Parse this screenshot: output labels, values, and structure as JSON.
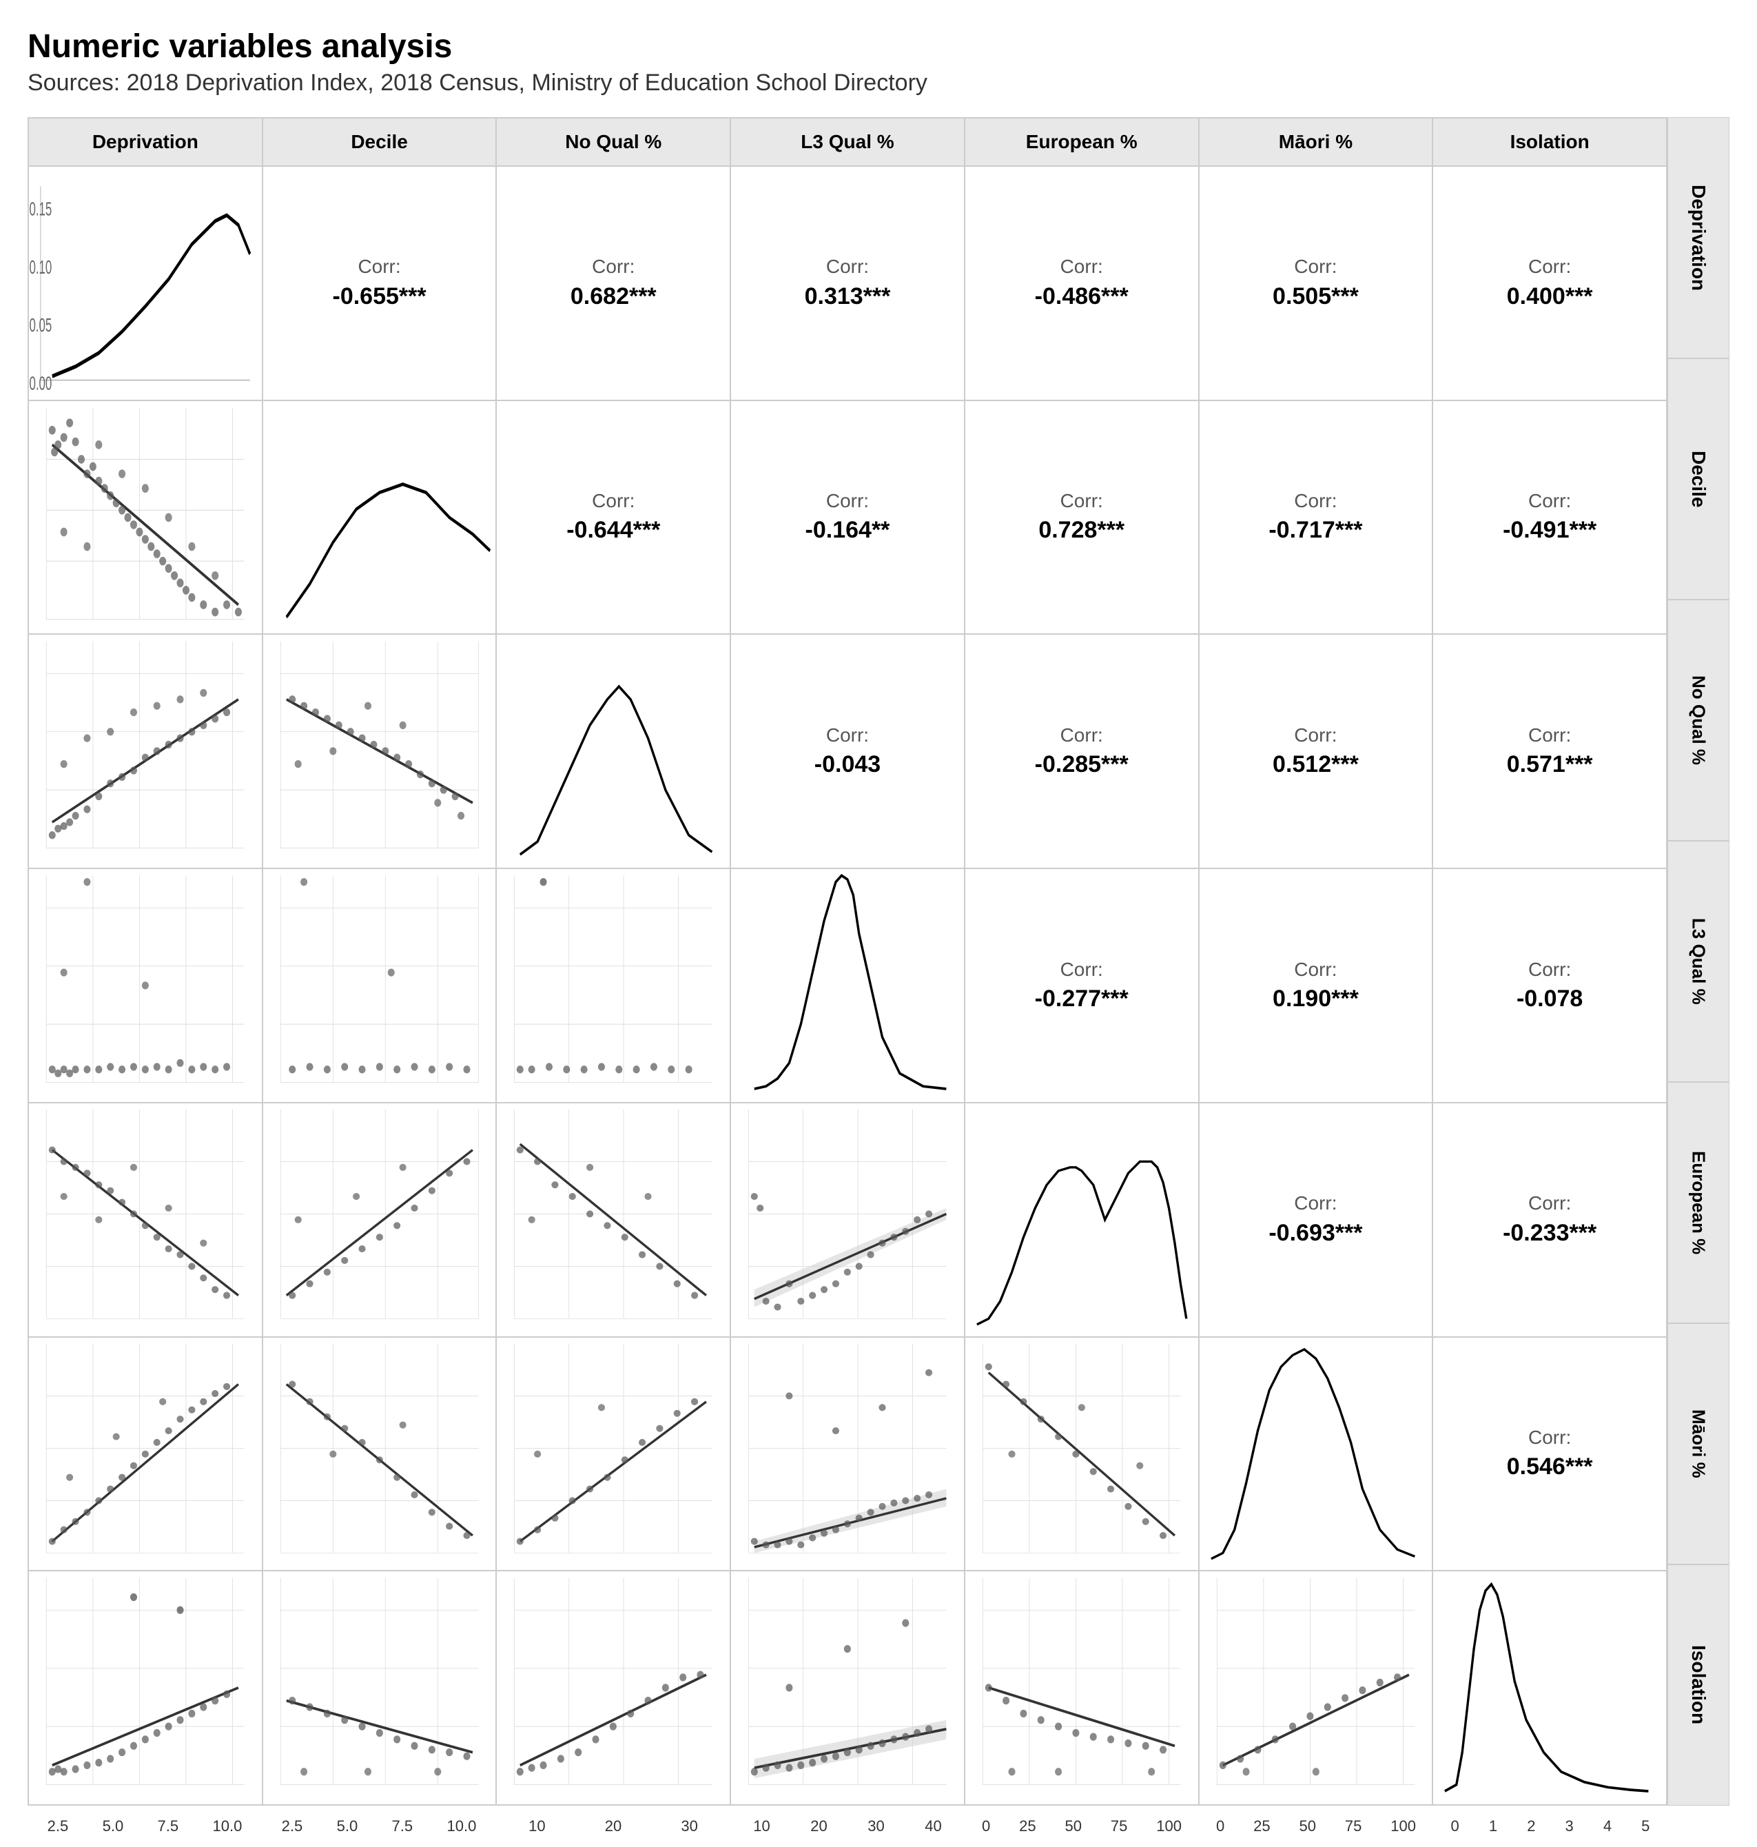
{
  "title": "Numeric variables analysis",
  "subtitle": "Sources: 2018 Deprivation Index, 2018 Census, Ministry of Education School Directory",
  "columns": [
    "Deprivation",
    "Decile",
    "No Qual %",
    "L3 Qual %",
    "European %",
    "Māori %",
    "Isolation"
  ],
  "rows": [
    "Deprivation",
    "Decile",
    "No Qual %",
    "L3 Qual %",
    "European %",
    "Māori %",
    "Isolation"
  ],
  "x_axis_ticks": [
    [
      "2.5",
      "5.0",
      "7.5",
      "10.0"
    ],
    [
      "2.5",
      "5.0",
      "7.5",
      "10.0"
    ],
    [
      "10",
      "20",
      "30"
    ],
    [
      "10",
      "20",
      "30",
      "40"
    ],
    [
      "0",
      "25",
      "50",
      "75",
      "100"
    ],
    [
      "0",
      "25",
      "50",
      "75",
      "100"
    ],
    [
      "0",
      "1",
      "2",
      "3",
      "4",
      "5"
    ]
  ],
  "correlations": {
    "r1c2": {
      "label": "Corr:",
      "value": "-0.655***"
    },
    "r1c3": {
      "label": "Corr:",
      "value": "0.682***"
    },
    "r1c4": {
      "label": "Corr:",
      "value": "0.313***"
    },
    "r1c5": {
      "label": "Corr:",
      "value": "-0.486***"
    },
    "r1c6": {
      "label": "Corr:",
      "value": "0.505***"
    },
    "r1c7": {
      "label": "Corr:",
      "value": "0.400***"
    },
    "r2c3": {
      "label": "Corr:",
      "value": "-0.644***"
    },
    "r2c4": {
      "label": "Corr:",
      "value": "-0.164**"
    },
    "r2c5": {
      "label": "Corr:",
      "value": "0.728***"
    },
    "r2c6": {
      "label": "Corr:",
      "value": "-0.717***"
    },
    "r2c7": {
      "label": "Corr:",
      "value": "-0.491***"
    },
    "r3c4": {
      "label": "Corr:",
      "value": "-0.043"
    },
    "r3c5": {
      "label": "Corr:",
      "value": "-0.285***"
    },
    "r3c6": {
      "label": "Corr:",
      "value": "0.512***"
    },
    "r3c7": {
      "label": "Corr:",
      "value": "0.571***"
    },
    "r4c5": {
      "label": "Corr:",
      "value": "-0.277***"
    },
    "r4c6": {
      "label": "Corr:",
      "value": "0.190***"
    },
    "r4c7": {
      "label": "Corr:",
      "value": "-0.078"
    },
    "r5c6": {
      "label": "Corr:",
      "value": "-0.693***"
    },
    "r5c7": {
      "label": "Corr:",
      "value": "-0.233***"
    },
    "r6c7": {
      "label": "Corr:",
      "value": "0.546***"
    }
  },
  "accent_color": "#333333"
}
